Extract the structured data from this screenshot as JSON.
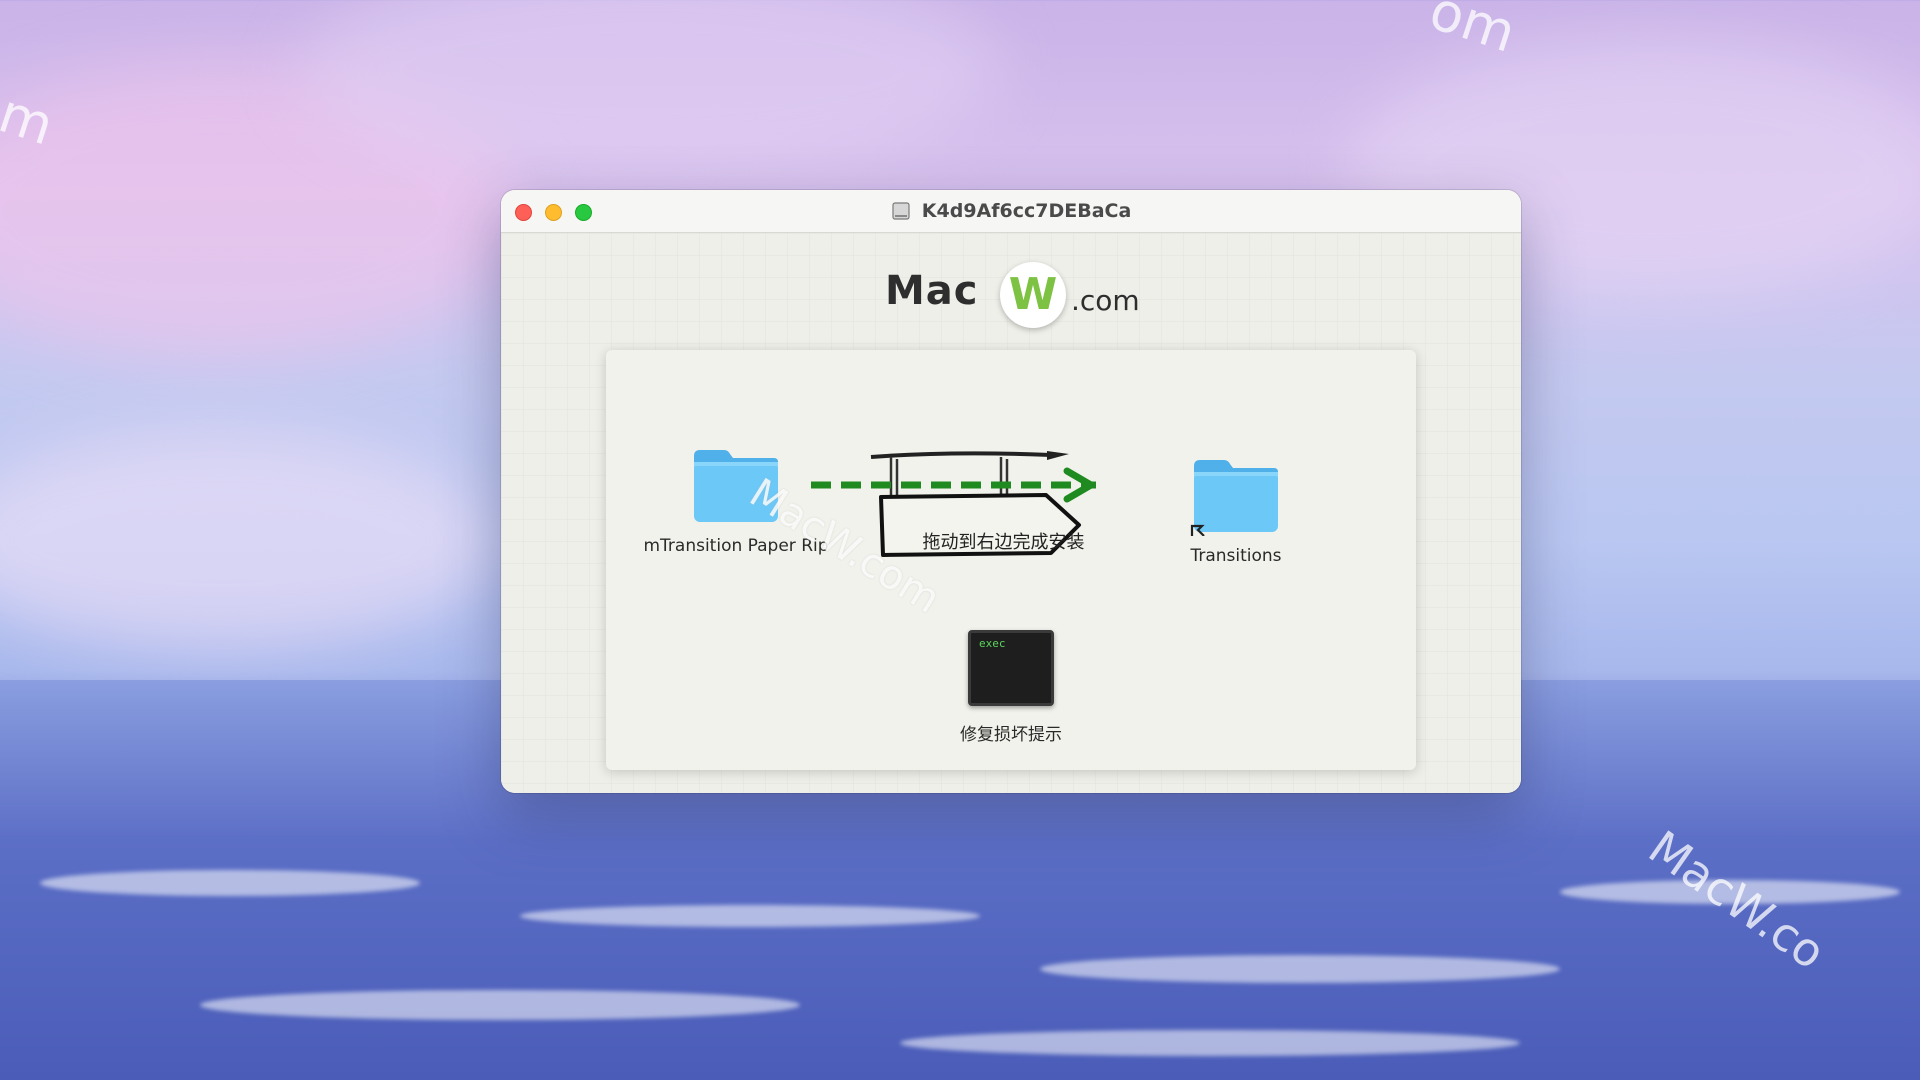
{
  "window": {
    "title": "K4d9Af6cc7DEBaCa"
  },
  "logo": {
    "brand": "Mac",
    "badge": "W",
    "suffix": ".com"
  },
  "installer": {
    "source_item": "mTransition Paper Rip",
    "target_item": "Transitions",
    "instruction": "拖动到右边完成安装",
    "exec_badge": "exec",
    "exec_item": "修复损坏提示"
  },
  "watermarks": {
    "top_right": "om",
    "left": "m",
    "bottom_right": "MacW.co",
    "panel": "MacW.com"
  },
  "colors": {
    "arrow": "#1f8a1f",
    "folder": "#6cc8f7",
    "folder_tab": "#4fb0ea"
  }
}
